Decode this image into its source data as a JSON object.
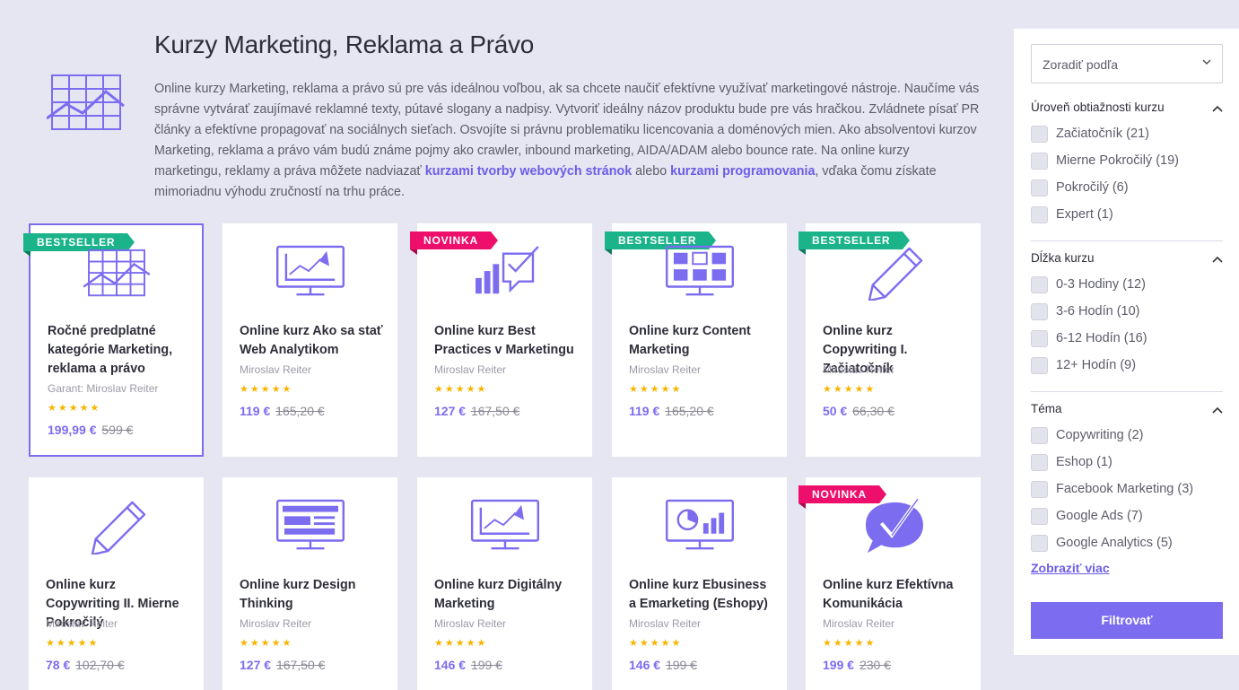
{
  "header": {
    "title": "Kurzy Marketing, Reklama a Právo",
    "intro_parts": [
      "Online kurzy Marketing, reklama a právo sú pre vás ideálnou voľbou, ak sa chcete naučiť efektívne využívať marketingové nástroje. Naučíme vás správne vytvárať zaujímavé reklamné texty, pútavé slogany a nadpisy. Vytvoriť ideálny názov produktu bude pre vás hračkou. Zvládnete písať PR články a efektívne propagovať na sociálnych sieťach. Osvojíte si právnu problematiku licencovania a doménových mien. Ako absolventovi kurzov Marketing, reklama a právo vám budú známe pojmy ako crawler, inbound marketing, AIDA/ADAM alebo bounce rate. Na online kurzy marketingu, reklamy a práva môžete nadviazať ",
      "kurzami tvorby webových stránok",
      " alebo ",
      "kurzami programovania",
      ", vďaka čomu získate mimoriadnu výhodu zručností na trhu práce."
    ]
  },
  "courses": [
    {
      "title": "Ročné predplatné kategórie Marketing, reklama a právo",
      "author": "Garant: Miroslav Reiter",
      "stars": "★★★★★",
      "price": "199,99 €",
      "old_price": "599 €",
      "badge": "BESTSELLER",
      "icon": "grid-chart-icon"
    },
    {
      "title": "Online kurz Ako sa stať Web Analytikom",
      "author": "Miroslav Reiter",
      "stars": "★★★★★",
      "price": "119 €",
      "old_price": "165,20 €",
      "badge": "",
      "icon": "monitor-chart-icon"
    },
    {
      "title": "Online kurz Best Practices v Marketingu",
      "author": "Miroslav Reiter",
      "stars": "★★★★★",
      "price": "127 €",
      "old_price": "167,50 €",
      "badge": "NOVINKA",
      "icon": "bars-check-icon"
    },
    {
      "title": "Online kurz Content Marketing",
      "author": "Miroslav Reiter",
      "stars": "★★★★★",
      "price": "119 €",
      "old_price": "165,20 €",
      "badge": "BESTSELLER",
      "icon": "monitor-grid-icon"
    },
    {
      "title": "Online kurz Copywriting I. Začiatočník",
      "author": "Miroslav Reiter",
      "stars": "★★★★★",
      "price": "50 €",
      "old_price": "66,30 €",
      "badge": "BESTSELLER",
      "icon": "pencil-icon"
    },
    {
      "title": "Online kurz Copywriting II. Mierne Pokročilý",
      "author": "Miroslav Reiter",
      "stars": "★★★★★",
      "price": "78 €",
      "old_price": "102,70 €",
      "badge": "",
      "icon": "pencil-icon"
    },
    {
      "title": "Online kurz Design Thinking",
      "author": "Miroslav Reiter",
      "stars": "★★★★★",
      "price": "127 €",
      "old_price": "167,50 €",
      "badge": "",
      "icon": "monitor-layout-icon"
    },
    {
      "title": "Online kurz Digitálny Marketing",
      "author": "Miroslav Reiter",
      "stars": "★★★★★",
      "price": "146 €",
      "old_price": "199 €",
      "badge": "",
      "icon": "monitor-chart-icon"
    },
    {
      "title": "Online kurz Ebusiness a Emarketing (Eshopy)",
      "author": "Miroslav Reiter",
      "stars": "★★★★★",
      "price": "146 €",
      "old_price": "199 €",
      "badge": "",
      "icon": "monitor-pie-icon"
    },
    {
      "title": "Online kurz Efektívna Komunikácia",
      "author": "Miroslav Reiter",
      "stars": "★★★★★",
      "price": "199 €",
      "old_price": "230 €",
      "badge": "NOVINKA",
      "icon": "speech-check-icon"
    }
  ],
  "sidebar": {
    "sort_label": "Zoradiť podľa",
    "groups": [
      {
        "title": "Úroveň obtiažnosti kurzu",
        "options": [
          "Začiatočník (21)",
          "Mierne Pokročilý (19)",
          "Pokročilý (6)",
          "Expert (1)"
        ]
      },
      {
        "title": "Dĺžka kurzu",
        "options": [
          "0-3 Hodiny (12)",
          "3-6 Hodín (10)",
          "6-12 Hodín (16)",
          "12+ Hodín (9)"
        ]
      },
      {
        "title": "Téma",
        "options": [
          "Copywriting (2)",
          "Eshop (1)",
          "Facebook Marketing (3)",
          "Google Ads (7)",
          "Google Analytics (5)"
        ]
      }
    ],
    "show_more": "Zobraziť viac",
    "filter_button": "Filtrovať"
  },
  "colors": {
    "accent": "#7c6cf0",
    "bestseller": "#1bb38a",
    "new": "#ee0f6d",
    "star": "#f7b500"
  }
}
